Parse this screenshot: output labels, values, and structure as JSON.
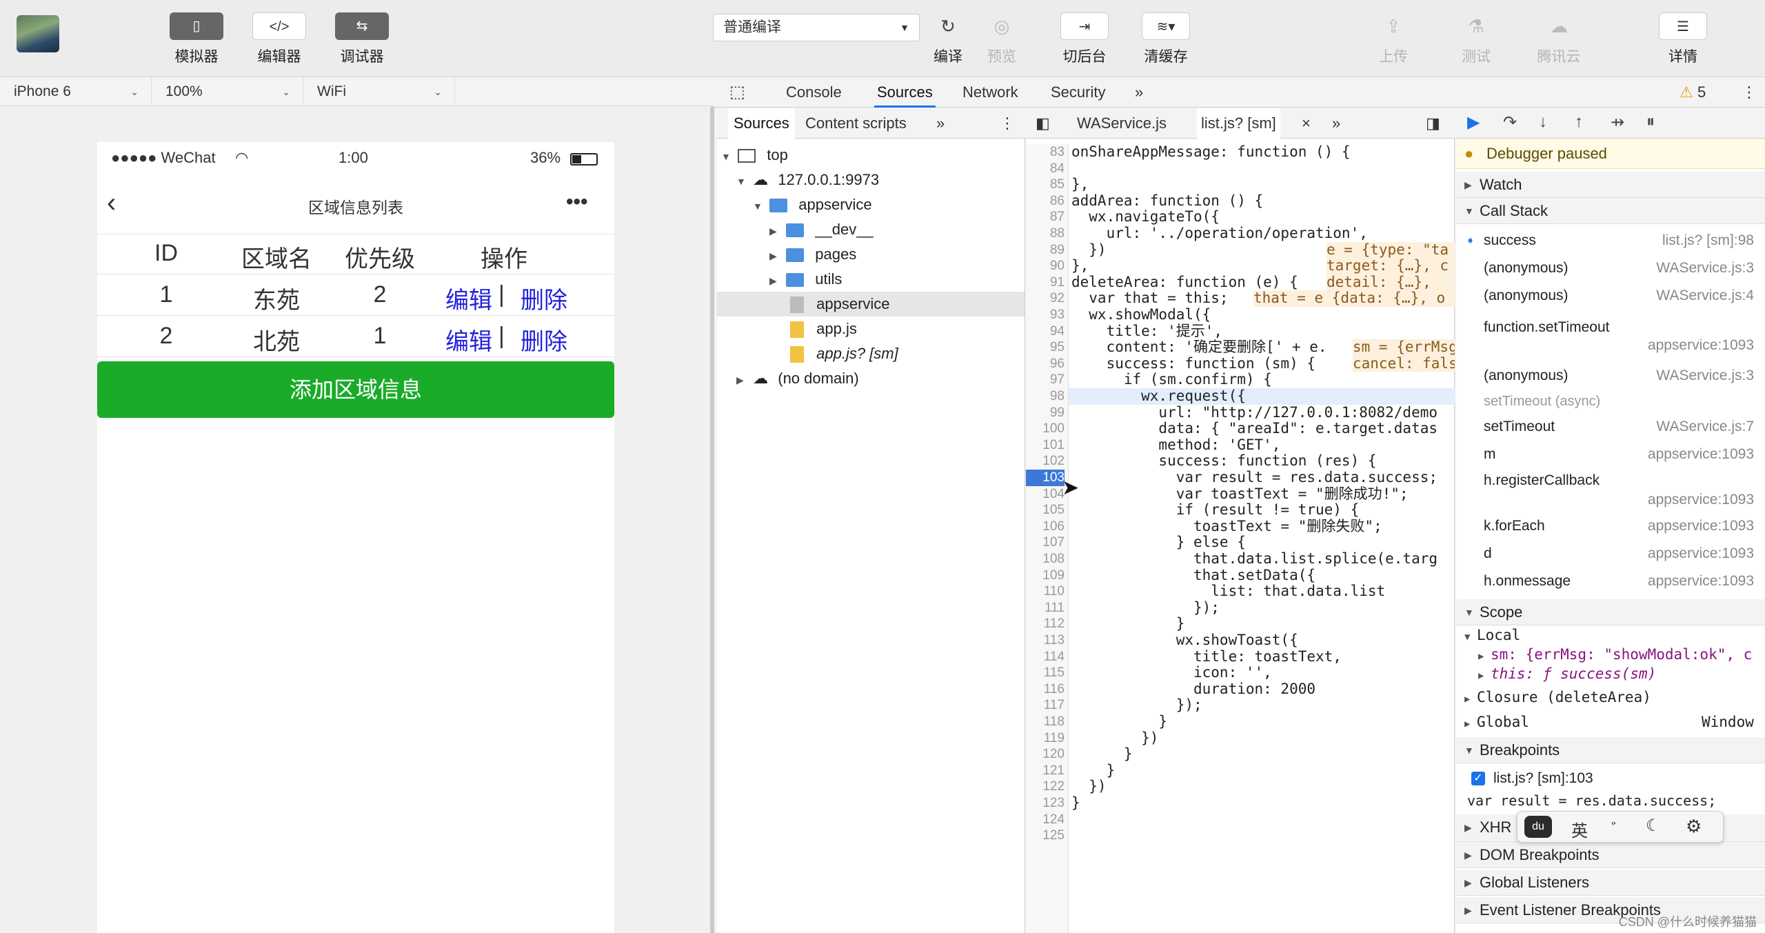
{
  "toolbar": {
    "simulator": "模拟器",
    "editor": "编辑器",
    "debugger": "调试器",
    "compile_mode": "普通编译",
    "compile": "编译",
    "preview": "预览",
    "background": "切后台",
    "clear_cache": "清缓存",
    "upload": "上传",
    "test": "测试",
    "tencent_cloud": "腾讯云",
    "details": "详情"
  },
  "device_bar": {
    "device": "iPhone 6",
    "zoom": "100%",
    "network": "WiFi"
  },
  "phone": {
    "carrier": "●●●●● WeChat",
    "time": "1:00",
    "battery": "36%",
    "title": "区域信息列表",
    "more": "•••",
    "headers": [
      "ID",
      "区域名",
      "优先级",
      "操作"
    ],
    "rows": [
      {
        "id": "1",
        "name": "东苑",
        "priority": "2",
        "edit": "编辑",
        "sep": "|",
        "delete": "删除"
      },
      {
        "id": "2",
        "name": "北苑",
        "priority": "1",
        "edit": "编辑",
        "sep": "|",
        "delete": "删除"
      }
    ],
    "add_button": "添加区域信息"
  },
  "devtools": {
    "tabs": [
      "Console",
      "Sources",
      "Network",
      "Security"
    ],
    "more": "»",
    "warnings": "5",
    "nav_tabs": [
      "Sources",
      "Content scripts"
    ],
    "tree": {
      "top": "top",
      "host": "127.0.0.1:9973",
      "appservice_folder": "appservice",
      "dev": "__dev__",
      "pages": "pages",
      "utils": "utils",
      "appservice_file": "appservice",
      "app_js": "app.js",
      "app_js_sm": "app.js? [sm]",
      "no_domain": "(no domain)"
    },
    "editor_tabs": [
      "WAService.js",
      "list.js? [sm]"
    ],
    "close": "×"
  },
  "code": {
    "l83": "onShareAppMessage: function () {",
    "l85": "},",
    "l86": "addArea: function () {",
    "l87": "  wx.navigateTo({",
    "l88": "    url: '../operation/operation',",
    "l89": "  })",
    "l90": "},",
    "l91": "deleteArea: function (e) {",
    "l92": "  var that = this;",
    "l93": "  wx.showModal({",
    "l94": "    title: '提示',",
    "l95": "    content: '确定要删除[' + e.",
    "l96": "    success: function (sm) {",
    "l97": "      if (sm.confirm) {",
    "l98": "        wx.request({",
    "l99": "          url: \"http://127.0.0.1:8082/demo",
    "l100": "          data: { \"areaId\": e.target.datas",
    "l101": "          method: 'GET',",
    "l102": "          success: function (res) {",
    "l103": "            var result = res.data.success;",
    "l104": "            var toastText = \"删除成功!\";",
    "l105": "            if (result != true) {",
    "l106": "              toastText = \"删除失败\";",
    "l107": "            } else {",
    "l108": "              that.data.list.splice(e.targ",
    "l109": "              that.setData({",
    "l110": "                list: that.data.list",
    "l111": "              });",
    "l112": "            }",
    "l113": "            wx.showToast({",
    "l114": "              title: toastText,",
    "l115": "              icon: '',",
    "l116": "              duration: 2000",
    "l117": "            });",
    "l118": "          }",
    "l119": "        })",
    "l120": "      }",
    "l121": "    }",
    "l122": "  })",
    "l123": "}",
    "inline_e1": "e = {type: \"ta",
    "inline_e2": "target: {…}, c",
    "inline_e3": "detail: {…}, ",
    "inline_that": "that = e {data: {…}, o",
    "inline_sm": "sm = {errMsg",
    "inline_cancel": "cancel: fals"
  },
  "debugger": {
    "paused": "Debugger paused",
    "watch": "Watch",
    "call_stack": "Call Stack",
    "frames": [
      {
        "name": "success",
        "loc": "list.js? [sm]:98"
      },
      {
        "name": "(anonymous)",
        "loc": "WAService.js:3"
      },
      {
        "name": "(anonymous)",
        "loc": "WAService.js:4"
      },
      {
        "name": "function.setTimeout",
        "loc": "appservice:1093"
      },
      {
        "name": "(anonymous)",
        "loc": "WAService.js:3"
      },
      {
        "name": "setTimeout (async)",
        "loc": ""
      },
      {
        "name": "setTimeout",
        "loc": "WAService.js:7"
      },
      {
        "name": "m",
        "loc": "appservice:1093"
      },
      {
        "name": "h.registerCallback",
        "loc": "appservice:1093"
      },
      {
        "name": "k.forEach",
        "loc": "appservice:1093"
      },
      {
        "name": "d",
        "loc": "appservice:1093"
      },
      {
        "name": "h.onmessage",
        "loc": "appservice:1093"
      }
    ],
    "scope": "Scope",
    "local": "Local",
    "sm_var": "sm: {errMsg: \"showModal:ok\", c",
    "this_var": "this: ƒ success(sm)",
    "closure": "Closure (deleteArea)",
    "global": "Global",
    "global_val": "Window",
    "breakpoints": "Breakpoints",
    "bp_file": "list.js? [sm]:103",
    "bp_code": "var result = res.data.success;",
    "xhr": "XHR",
    "dom_bp": "DOM Breakpoints",
    "global_listeners": "Global Listeners",
    "event_listener_bp": "Event Listener Breakpoints"
  },
  "ime": {
    "en": "英",
    "punct": "゛"
  },
  "watermark": "CSDN @什么时候养猫猫"
}
